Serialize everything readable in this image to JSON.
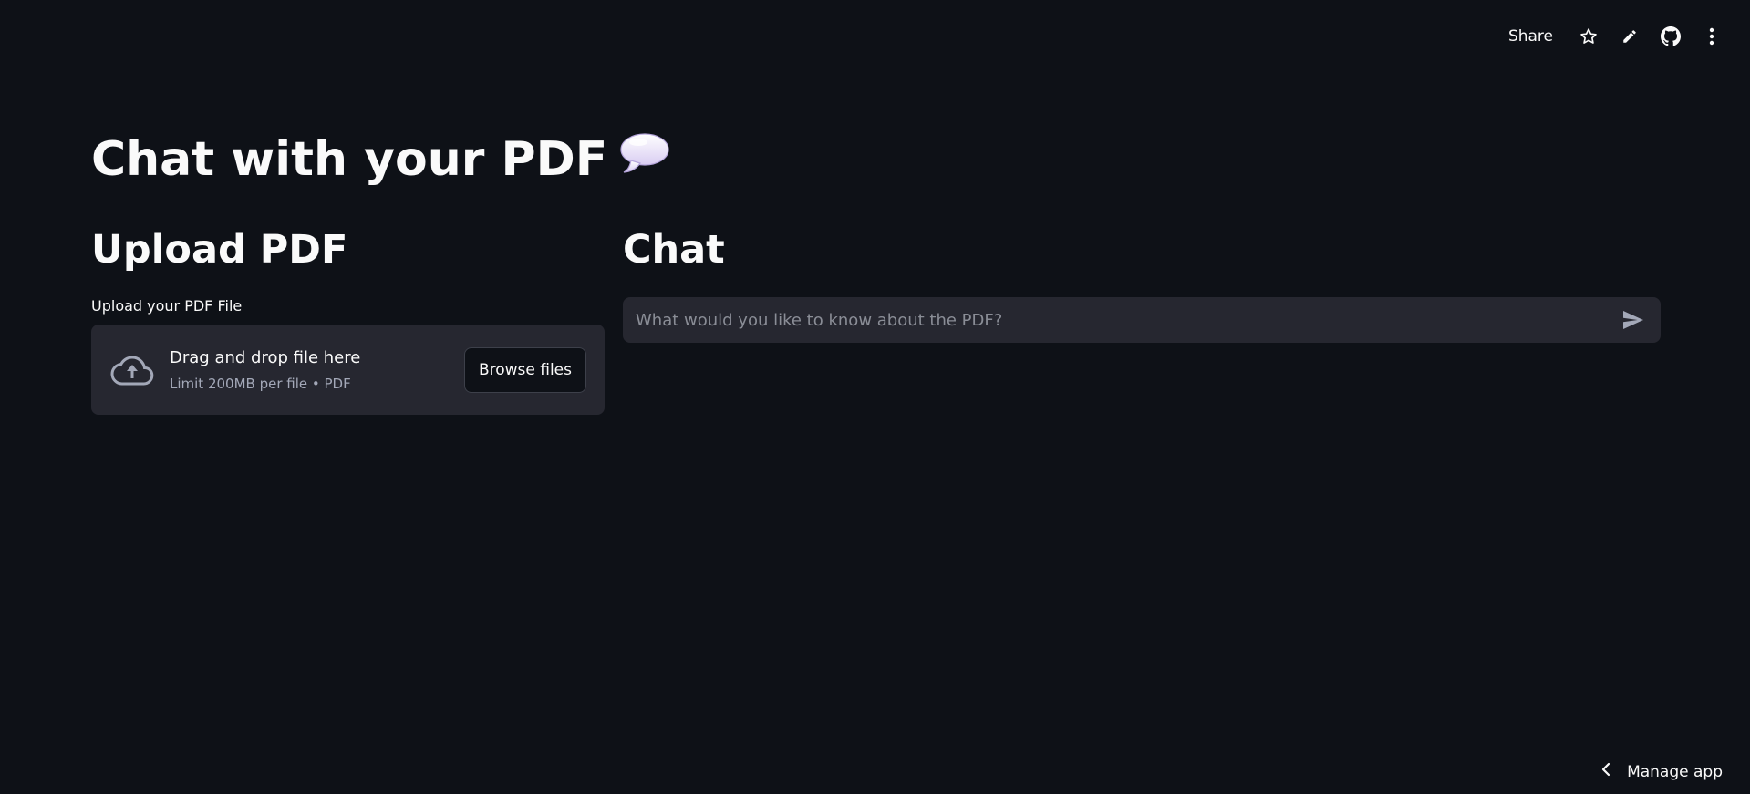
{
  "toolbar": {
    "share_label": "Share",
    "icons": [
      "star-icon",
      "pencil-icon",
      "github-icon",
      "more-vertical-icon"
    ]
  },
  "page": {
    "title": "Chat with your PDF",
    "title_icon": "speech-bubble-icon"
  },
  "upload": {
    "heading": "Upload PDF",
    "label": "Upload your PDF File",
    "dropzone_title": "Drag and drop file here",
    "dropzone_subtitle": "Limit 200MB per file • PDF",
    "browse_label": "Browse files",
    "icon": "cloud-upload-icon"
  },
  "chat": {
    "heading": "Chat",
    "placeholder": "What would you like to know about the PDF?",
    "value": "",
    "send_icon": "send-icon"
  },
  "footer": {
    "manage_label": "Manage app",
    "icon": "chevron-left-icon"
  },
  "colors": {
    "background": "#0e1117",
    "surface": "#262730",
    "text": "#fafafa",
    "muted_text": "#a3a8b8"
  }
}
